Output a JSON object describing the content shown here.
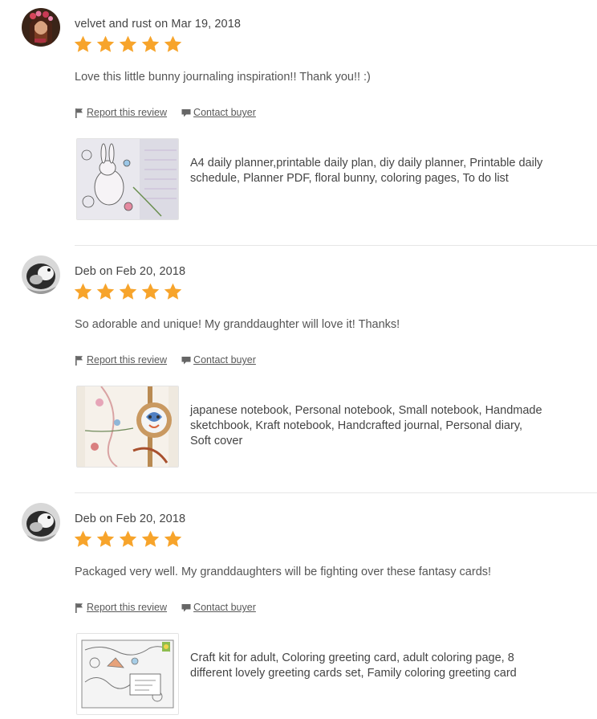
{
  "colors": {
    "star": "#f7a42b",
    "divider": "#e6e6e6",
    "text": "#444444"
  },
  "icons": {
    "star": "star-icon",
    "flag": "flag-icon",
    "contact": "message-icon"
  },
  "reviews": [
    {
      "byline": "velvet and rust on Mar 19, 2018",
      "rating": 5,
      "text": "Love this little bunny journaling inspiration!! Thank you!! :)",
      "report_label": "Report this review",
      "contact_label": "Contact buyer",
      "listing_title": "A4 daily planner,printable daily plan, diy daily planner, Printable daily schedule, Planner PDF, floral bunny, coloring pages, To do list"
    },
    {
      "byline": "Deb on Feb 20, 2018",
      "rating": 5,
      "text": "So adorable and unique! My granddaughter will love it! Thanks!",
      "report_label": "Report this review",
      "contact_label": "Contact buyer",
      "listing_title": "japanese notebook, Personal notebook, Small notebook, Handmade sketchbook, Kraft notebook, Handcrafted journal, Personal diary, Soft cover"
    },
    {
      "byline": "Deb on Feb 20, 2018",
      "rating": 5,
      "text": "Packaged very well. My granddaughters will be fighting over these fantasy cards!",
      "report_label": "Report this review",
      "contact_label": "Contact buyer",
      "listing_title": "Craft kit for adult, Coloring greeting card, adult coloring page, 8 different lovely greeting cards set, Family coloring greeting card"
    }
  ]
}
